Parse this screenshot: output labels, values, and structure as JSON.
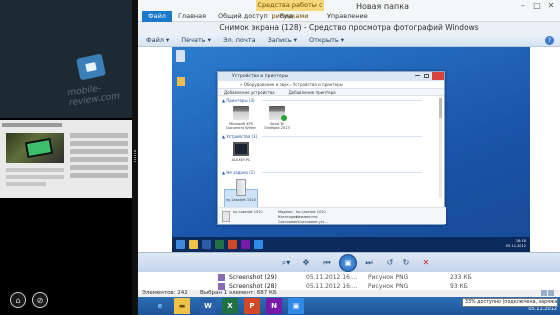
{
  "left_pane": {
    "watermark": "mobile-review.com",
    "bottom_buttons": [
      "snap-icon",
      "close-icon"
    ]
  },
  "explorer": {
    "window_title": "Новая папка",
    "context_tab": "Средства работы с рисунками",
    "tabs": {
      "file": "Файл",
      "home": "Главная",
      "share": "Общий доступ",
      "view": "Вид",
      "manage": "Управление"
    },
    "files": [
      {
        "name": "Screenshot (29)",
        "date": "05.11.2012 16:...",
        "type": "Рисунок PNG",
        "size": "233 КБ"
      },
      {
        "name": "Screenshot (28)",
        "date": "05.11.2012 16:...",
        "type": "Рисунок PNG",
        "size": "93 КБ"
      }
    ],
    "status": {
      "items": "Элементов: 242",
      "selected": "Выбран 1 элемент: 687 КБ"
    }
  },
  "viewer": {
    "title": "Снимок экрана (128) - Средство просмотра фотографий Windows",
    "menu": [
      "Файл ▾",
      "Печать ▾",
      "Эл. почта",
      "Запись ▾",
      "Открыть ▾"
    ],
    "help_label": "?"
  },
  "inner_screenshot": {
    "window_title": "Устройства и принтеры",
    "address": "« Оборудование и звук › Устройства и принтеры",
    "toolbar": [
      "Добавление устройства",
      "Добавление принтера"
    ],
    "group_printers": "▲ Принтеры (3)",
    "group_devices": "▲ Устройства (1)",
    "group_unspecified": "▲ Не задано (1)",
    "printers": [
      {
        "label": "Microsoft XPS Document Writer"
      },
      {
        "label": "Send To OneNote 2013"
      }
    ],
    "device_label": "ALEXEY-PC",
    "unspecified_label": "hp LaserJet 1010",
    "details": {
      "name": "hp LaserJet 1010",
      "model_label": "Модель:",
      "model": "hp LaserJet 1010",
      "category_label": "Категория:",
      "category": "Неизвестно",
      "status_label": "Состояние:",
      "status": "Состояние уст..."
    },
    "clock": {
      "time": "16:18",
      "date": "05.11.2012"
    }
  },
  "taskbar": {
    "apps": [
      "ie-icon",
      "explorer-icon",
      "word-icon",
      "excel-icon",
      "powerpoint-icon",
      "onenote-icon",
      "photos-icon"
    ],
    "tooltip": "33% доступно (подключена, заряжается)",
    "date": "05.11.2012"
  },
  "colors": {
    "ribbon_file": "#1979ca",
    "context_tab": "#f6d77a",
    "taskbar": "#1d5596",
    "desktop": "#1b55a9"
  }
}
